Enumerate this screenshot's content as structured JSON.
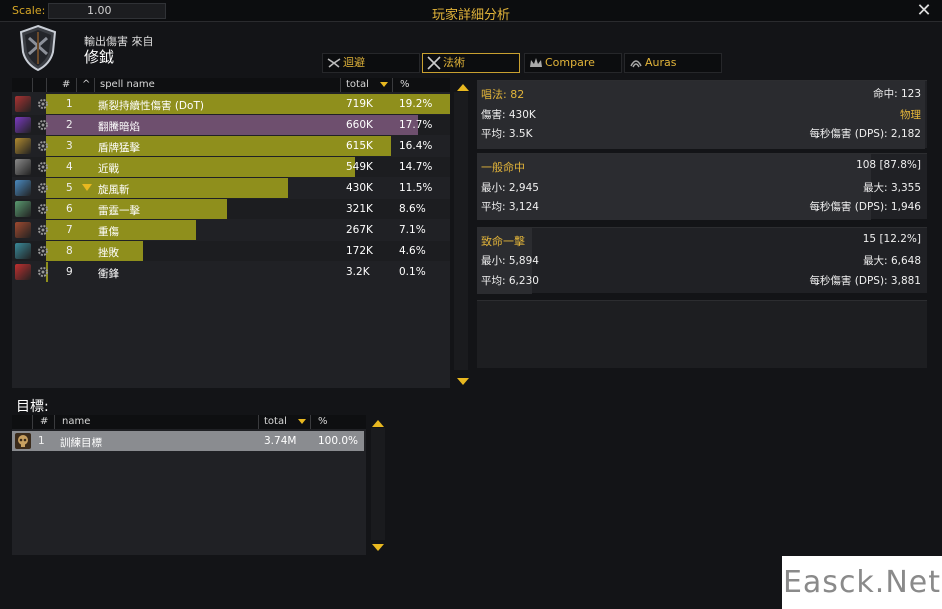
{
  "titlebar": {
    "scale_label": "Scale:",
    "scale_value": "1.00",
    "title": "玩家詳細分析",
    "close": "✕"
  },
  "header": {
    "source_label": "輸出傷害 來自",
    "player_name": "修鉞"
  },
  "tabs": [
    {
      "label": "迴避",
      "icon": "avoidance-icon",
      "active": false
    },
    {
      "label": "法術",
      "icon": "crossed-swords-icon",
      "active": true
    },
    {
      "label": "Compare",
      "icon": "crown-icon",
      "active": false
    },
    {
      "label": "Auras",
      "icon": "aura-icon",
      "active": false
    }
  ],
  "spell_table": {
    "headers": {
      "num": "#",
      "sort": "^",
      "name": "spell name",
      "total": "total",
      "pct": "%"
    },
    "rows": [
      {
        "num": "1",
        "name": "撕裂持續性傷害 (DoT)",
        "total": "719K",
        "pct": "19.2%",
        "fill": 1.0,
        "color": "#8f8f1c",
        "icon_color": "#a33"
      },
      {
        "num": "2",
        "name": "翻騰暗焰",
        "total": "660K",
        "pct": "17.7%",
        "fill": 0.92,
        "color": "#6e4f6e",
        "icon_color": "#7a3ac0"
      },
      {
        "num": "3",
        "name": "盾牌猛擊",
        "total": "615K",
        "pct": "16.4%",
        "fill": 0.855,
        "color": "#8f8f1c",
        "icon_color": "#b08a30"
      },
      {
        "num": "4",
        "name": "近戰",
        "total": "549K",
        "pct": "14.7%",
        "fill": 0.765,
        "color": "#8f8f1c",
        "icon_color": "#8a8a8a"
      },
      {
        "num": "5",
        "name": "旋風斬",
        "total": "430K",
        "pct": "11.5%",
        "fill": 0.6,
        "color": "#8f8f1c",
        "icon_color": "#4a8ac0",
        "expanded": true
      },
      {
        "num": "6",
        "name": "雷霆一擊",
        "total": "321K",
        "pct": "8.6%",
        "fill": 0.447,
        "color": "#8f8f1c",
        "icon_color": "#5a9a70"
      },
      {
        "num": "7",
        "name": "重傷",
        "total": "267K",
        "pct": "7.1%",
        "fill": 0.371,
        "color": "#8f8f1c",
        "icon_color": "#a04a30"
      },
      {
        "num": "8",
        "name": "挫敗",
        "total": "172K",
        "pct": "4.6%",
        "fill": 0.239,
        "color": "#8f8f1c",
        "icon_color": "#3a8a9a"
      },
      {
        "num": "9",
        "name": "衝鋒",
        "total": "3.2K",
        "pct": "0.1%",
        "fill": 0.004,
        "color": "#8f8f1c",
        "icon_color": "#c03030"
      }
    ]
  },
  "detail_cast": {
    "casts_label": "唱法: 82",
    "hits_label": "命中: 123",
    "damage_label": "傷害: 430K",
    "school_label": "物理",
    "average_label": "平均: 3.5K",
    "dps_label": "每秒傷害 (DPS): 2,182"
  },
  "detail_normal": {
    "title": "一般命中",
    "count_label": "108 [87.8%]",
    "min_label": "最小: 2,945",
    "max_label": "最大: 3,355",
    "average_label": "平均: 3,124",
    "dps_label": "每秒傷害 (DPS): 1,946"
  },
  "detail_crit": {
    "title": "致命一擊",
    "count_label": "15 [12.2%]",
    "min_label": "最小: 5,894",
    "max_label": "最大: 6,648",
    "average_label": "平均: 6,230",
    "dps_label": "每秒傷害 (DPS): 3,881"
  },
  "targets": {
    "label": "目標:",
    "headers": {
      "num": "#",
      "name": "name",
      "total": "total",
      "pct": "%"
    },
    "rows": [
      {
        "num": "1",
        "name": "訓練目標",
        "total": "3.74M",
        "pct": "100.0%"
      }
    ]
  },
  "watermark": "Easck.Net"
}
